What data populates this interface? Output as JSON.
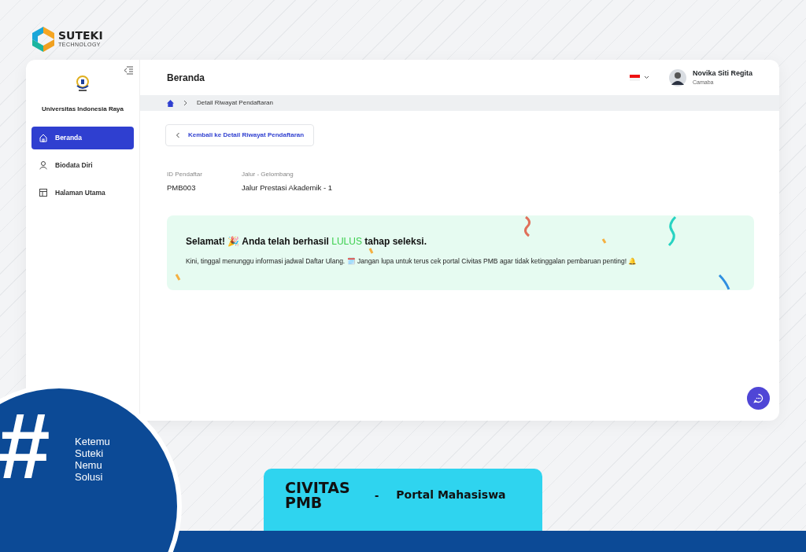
{
  "brand": {
    "name": "SUTEKI",
    "tagline": "TECHNOLOGY"
  },
  "sidebar": {
    "university": "Universitas Indonesia Raya",
    "items": [
      {
        "label": "Beranda",
        "kind": "home",
        "selected": true
      },
      {
        "label": "Biodata Diri",
        "kind": "person",
        "selected": false
      },
      {
        "label": "Halaman Utama",
        "kind": "layout",
        "selected": false
      }
    ]
  },
  "header": {
    "title": "Beranda",
    "user": {
      "name": "Novika Siti Regita",
      "role": "Camaba"
    }
  },
  "breadcrumb": [
    "Detail Riwayat Pendaftaran"
  ],
  "back_button": "Kembali ke Detail Riwayat Pendaftaran",
  "fields": [
    {
      "label": "ID Pendaftar",
      "value": "PMB003"
    },
    {
      "label": "Jalur - Gelombang",
      "value": "Jalur Prestasi Akademik - 1"
    }
  ],
  "announcement": {
    "title_before": "Selamat! 🎉 Anda telah berhasil",
    "highlight": "LULUS",
    "title_after": "tahap seleksi.",
    "message": "Kini, tinggal menunggu informasi jadwal Daftar Ulang. 🗓️ Jangan lupa untuk terus cek portal Civitas PMB agar tidak ketinggalan pembaruan penting! 🔔"
  },
  "hashtag": {
    "symbol": "#",
    "lines": [
      "Ketemu",
      "Suteki",
      "Nemu",
      "Solusi"
    ]
  },
  "banner": {
    "product": "CIVITAS PMB",
    "separator": "-",
    "subtitle": "Portal Mahasiswa"
  }
}
